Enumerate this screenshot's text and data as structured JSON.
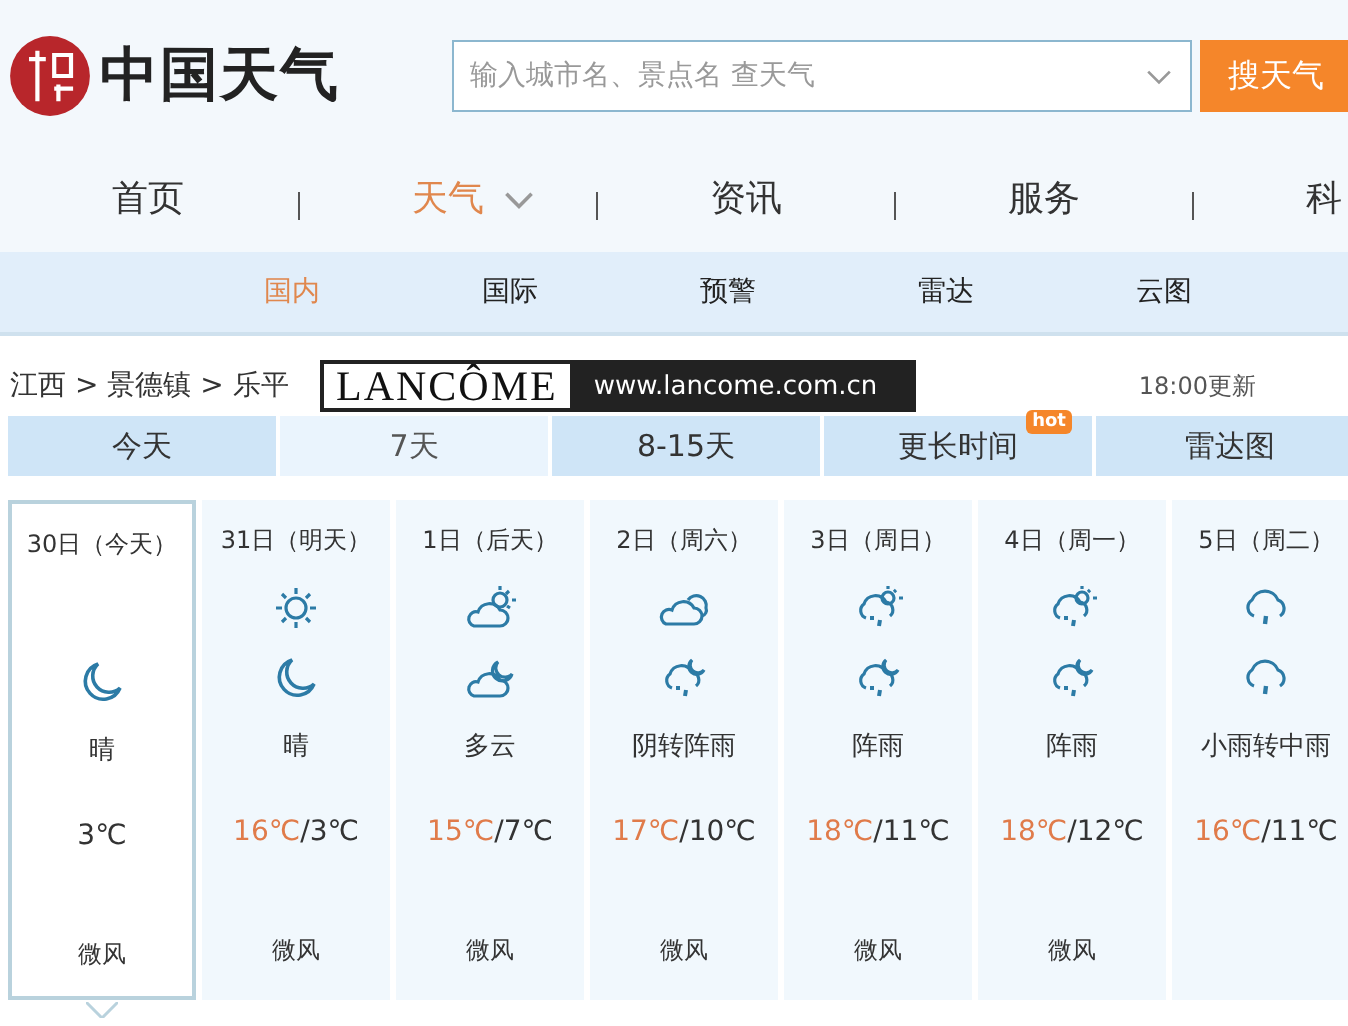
{
  "logo": {
    "title": "中国天气"
  },
  "search": {
    "placeholder": "输入城市名、景点名 查天气",
    "button": "搜天气"
  },
  "nav": [
    {
      "label": "首页",
      "selected": false,
      "dropdown": false
    },
    {
      "label": "天气",
      "selected": true,
      "dropdown": true
    },
    {
      "label": "资讯",
      "selected": false,
      "dropdown": false
    },
    {
      "label": "服务",
      "selected": false,
      "dropdown": false
    },
    {
      "label": "科",
      "selected": false,
      "dropdown": false
    }
  ],
  "subnav": [
    {
      "label": "国内",
      "selected": true
    },
    {
      "label": "国际",
      "selected": false
    },
    {
      "label": "预警",
      "selected": false
    },
    {
      "label": "雷达",
      "selected": false
    },
    {
      "label": "云图",
      "selected": false
    }
  ],
  "breadcrumb": "江西 > 景德镇 > 乐平",
  "ad": {
    "brand": "LANCÔME",
    "url": "www.lancome.com.cn"
  },
  "updated": "18:00更新",
  "tabs": [
    {
      "label": "今天",
      "selected": false
    },
    {
      "label": "7天",
      "selected": true
    },
    {
      "label": "8-15天",
      "selected": false
    },
    {
      "label": "更长时间",
      "selected": false,
      "badge": "hot"
    },
    {
      "label": "雷达图",
      "selected": false
    }
  ],
  "days": [
    {
      "date": "30日（今天）",
      "selected": true,
      "night_icon": {
        "kind": "moon"
      },
      "weather": "晴",
      "low": "3℃",
      "wind": "微风"
    },
    {
      "date": "31日（明天）",
      "selected": false,
      "day_icon": {
        "kind": "sun"
      },
      "night_icon": {
        "kind": "moon"
      },
      "weather": "晴",
      "high": "16℃",
      "separator": "/",
      "low": "3℃",
      "wind": "微风"
    },
    {
      "date": "1日（后天）",
      "selected": false,
      "day_icon": {
        "kind": "partly-cloudy"
      },
      "night_icon": {
        "kind": "cloud-moon"
      },
      "weather": "多云",
      "high": "15℃",
      "separator": "/",
      "low": "7℃",
      "wind": "微风"
    },
    {
      "date": "2日（周六）",
      "selected": false,
      "day_icon": {
        "kind": "overcast"
      },
      "night_icon": {
        "kind": "shower-night"
      },
      "weather": "阴转阵雨",
      "high": "17℃",
      "separator": "/",
      "low": "10℃",
      "wind": "微风"
    },
    {
      "date": "3日（周日）",
      "selected": false,
      "day_icon": {
        "kind": "shower"
      },
      "night_icon": {
        "kind": "shower-night"
      },
      "weather": "阵雨",
      "high": "18℃",
      "separator": "/",
      "low": "11℃",
      "wind": "微风"
    },
    {
      "date": "4日（周一）",
      "selected": false,
      "day_icon": {
        "kind": "shower"
      },
      "night_icon": {
        "kind": "shower-night"
      },
      "weather": "阵雨",
      "high": "18℃",
      "separator": "/",
      "low": "12℃",
      "wind": "微风"
    },
    {
      "date": "5日（周二）",
      "selected": false,
      "day_icon": {
        "kind": "rain"
      },
      "night_icon": {
        "kind": "rain"
      },
      "weather": "小雨转中雨",
      "high": "16℃",
      "separator": "/",
      "low": "11℃"
    }
  ]
}
